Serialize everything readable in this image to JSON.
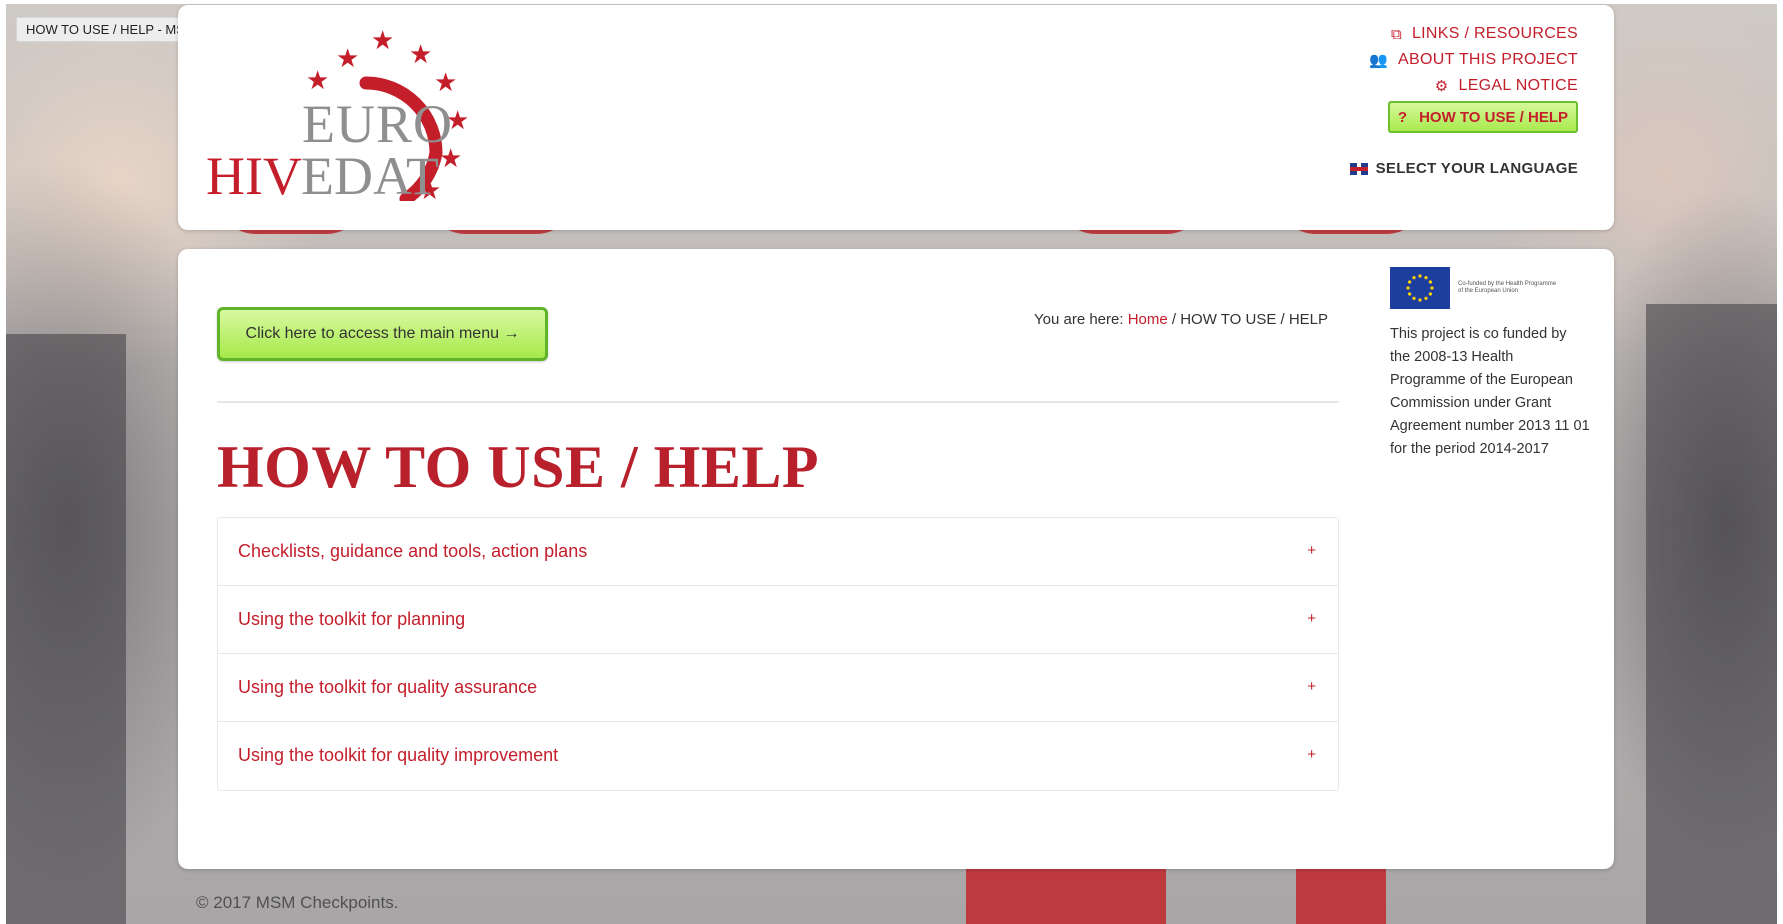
{
  "tab": {
    "title": "HOW TO USE / HELP - MSM Checkpoints"
  },
  "logo": {
    "euro": "EURO",
    "hiv": "HIV",
    "edat": "EDAT"
  },
  "top_nav": {
    "links": [
      {
        "label": "LINKS / RESOURCES",
        "icon": "external-link-icon"
      },
      {
        "label": "ABOUT THIS PROJECT",
        "icon": "users-icon"
      },
      {
        "label": "LEGAL NOTICE",
        "icon": "gear-icon"
      }
    ],
    "active": {
      "label": "HOW TO USE / HELP",
      "icon": "question-circle-icon"
    },
    "language": {
      "label": "SELECT YOUR LANGUAGE",
      "icon": "uk-flag-icon"
    }
  },
  "main": {
    "menu_button": "Click here to access the main menu →",
    "breadcrumb": {
      "prefix": "You are here: ",
      "home": "Home",
      "current": " / HOW TO USE / HELP"
    },
    "title": "HOW TO USE / HELP",
    "accordion": [
      {
        "label": "Checklists, guidance and tools, action plans",
        "toggle": "+"
      },
      {
        "label": "Using the toolkit for planning",
        "toggle": "+"
      },
      {
        "label": "Using the toolkit for quality assurance",
        "toggle": "+"
      },
      {
        "label": "Using the toolkit for quality improvement",
        "toggle": "+"
      }
    ]
  },
  "sidebar": {
    "eu_logo_text": "Co-funded by the Health Programme of the European Union",
    "funding": "This project is co funded by the 2008-13 Health Programme of the European Commission under Grant Agreement number 2013 11 01 for the period 2014-2017"
  },
  "footer": {
    "copyright": "© 2017 MSM Checkpoints."
  },
  "colors": {
    "brand_red": "#c41e2b",
    "button_green": "#a6e94a",
    "logo_grey": "#8f8f8f"
  }
}
